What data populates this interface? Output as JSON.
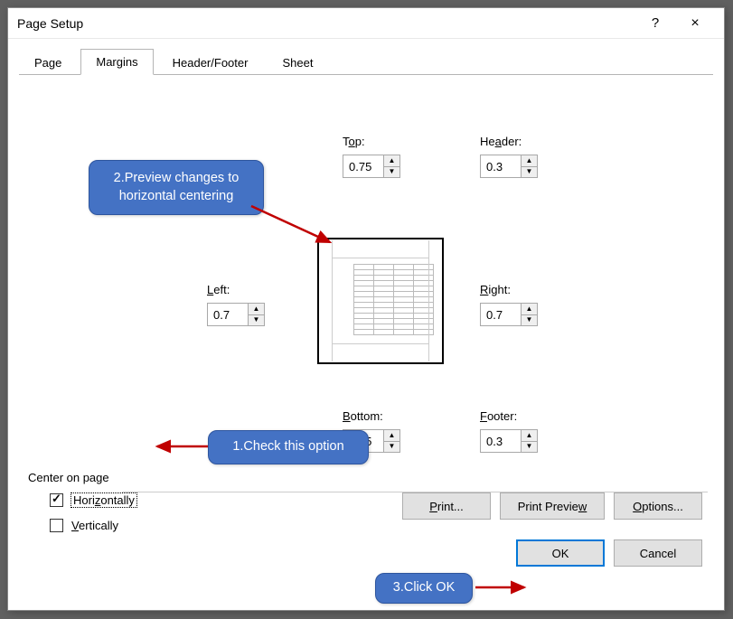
{
  "titlebar": {
    "title": "Page Setup",
    "help": "?",
    "close": "×"
  },
  "tabs": {
    "page": "Page",
    "margins": "Margins",
    "headerfooter": "Header/Footer",
    "sheet": "Sheet"
  },
  "margins": {
    "top_label_pre": "T",
    "top_label_u": "o",
    "top_label_post": "p:",
    "top_value": "0.75",
    "header_label_pre": "He",
    "header_label_u": "a",
    "header_label_post": "der:",
    "header_value": "0.3",
    "left_label_u": "L",
    "left_label_post": "eft:",
    "left_value": "0.7",
    "right_label_u": "R",
    "right_label_post": "ight:",
    "right_value": "0.7",
    "bottom_label_u": "B",
    "bottom_label_post": "ottom:",
    "bottom_value": "0.75",
    "footer_label_u": "F",
    "footer_label_post": "ooter:",
    "footer_value": "0.3"
  },
  "center": {
    "legend": "Center on page",
    "horiz_pre": "Hori",
    "horiz_u": "z",
    "horiz_post": "ontally",
    "vert_u": "V",
    "vert_post": "ertically"
  },
  "buttons": {
    "print_u": "P",
    "print_post": "rint...",
    "preview_pre": "Print Previe",
    "preview_u": "w",
    "options_u": "O",
    "options_post": "ptions...",
    "ok": "OK",
    "cancel": "Cancel"
  },
  "callouts": {
    "c1": "1.Check this option",
    "c2": "2.Preview changes to horizontal centering",
    "c3": "3.Click OK"
  }
}
